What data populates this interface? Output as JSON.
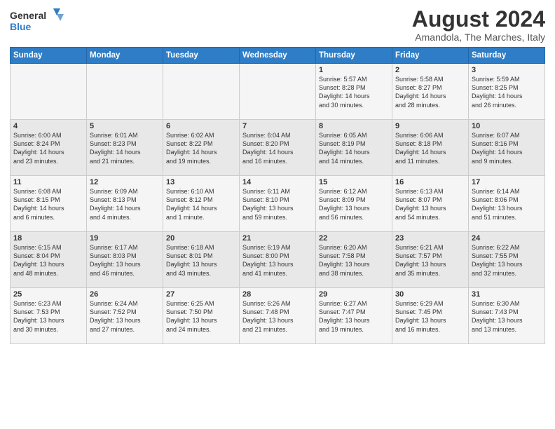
{
  "logo": {
    "line1": "General",
    "line2": "Blue"
  },
  "title": "August 2024",
  "location": "Amandola, The Marches, Italy",
  "days_header": [
    "Sunday",
    "Monday",
    "Tuesday",
    "Wednesday",
    "Thursday",
    "Friday",
    "Saturday"
  ],
  "weeks": [
    [
      {
        "day": "",
        "info": ""
      },
      {
        "day": "",
        "info": ""
      },
      {
        "day": "",
        "info": ""
      },
      {
        "day": "",
        "info": ""
      },
      {
        "day": "1",
        "info": "Sunrise: 5:57 AM\nSunset: 8:28 PM\nDaylight: 14 hours\nand 30 minutes."
      },
      {
        "day": "2",
        "info": "Sunrise: 5:58 AM\nSunset: 8:27 PM\nDaylight: 14 hours\nand 28 minutes."
      },
      {
        "day": "3",
        "info": "Sunrise: 5:59 AM\nSunset: 8:25 PM\nDaylight: 14 hours\nand 26 minutes."
      }
    ],
    [
      {
        "day": "4",
        "info": "Sunrise: 6:00 AM\nSunset: 8:24 PM\nDaylight: 14 hours\nand 23 minutes."
      },
      {
        "day": "5",
        "info": "Sunrise: 6:01 AM\nSunset: 8:23 PM\nDaylight: 14 hours\nand 21 minutes."
      },
      {
        "day": "6",
        "info": "Sunrise: 6:02 AM\nSunset: 8:22 PM\nDaylight: 14 hours\nand 19 minutes."
      },
      {
        "day": "7",
        "info": "Sunrise: 6:04 AM\nSunset: 8:20 PM\nDaylight: 14 hours\nand 16 minutes."
      },
      {
        "day": "8",
        "info": "Sunrise: 6:05 AM\nSunset: 8:19 PM\nDaylight: 14 hours\nand 14 minutes."
      },
      {
        "day": "9",
        "info": "Sunrise: 6:06 AM\nSunset: 8:18 PM\nDaylight: 14 hours\nand 11 minutes."
      },
      {
        "day": "10",
        "info": "Sunrise: 6:07 AM\nSunset: 8:16 PM\nDaylight: 14 hours\nand 9 minutes."
      }
    ],
    [
      {
        "day": "11",
        "info": "Sunrise: 6:08 AM\nSunset: 8:15 PM\nDaylight: 14 hours\nand 6 minutes."
      },
      {
        "day": "12",
        "info": "Sunrise: 6:09 AM\nSunset: 8:13 PM\nDaylight: 14 hours\nand 4 minutes."
      },
      {
        "day": "13",
        "info": "Sunrise: 6:10 AM\nSunset: 8:12 PM\nDaylight: 14 hours\nand 1 minute."
      },
      {
        "day": "14",
        "info": "Sunrise: 6:11 AM\nSunset: 8:10 PM\nDaylight: 13 hours\nand 59 minutes."
      },
      {
        "day": "15",
        "info": "Sunrise: 6:12 AM\nSunset: 8:09 PM\nDaylight: 13 hours\nand 56 minutes."
      },
      {
        "day": "16",
        "info": "Sunrise: 6:13 AM\nSunset: 8:07 PM\nDaylight: 13 hours\nand 54 minutes."
      },
      {
        "day": "17",
        "info": "Sunrise: 6:14 AM\nSunset: 8:06 PM\nDaylight: 13 hours\nand 51 minutes."
      }
    ],
    [
      {
        "day": "18",
        "info": "Sunrise: 6:15 AM\nSunset: 8:04 PM\nDaylight: 13 hours\nand 48 minutes."
      },
      {
        "day": "19",
        "info": "Sunrise: 6:17 AM\nSunset: 8:03 PM\nDaylight: 13 hours\nand 46 minutes."
      },
      {
        "day": "20",
        "info": "Sunrise: 6:18 AM\nSunset: 8:01 PM\nDaylight: 13 hours\nand 43 minutes."
      },
      {
        "day": "21",
        "info": "Sunrise: 6:19 AM\nSunset: 8:00 PM\nDaylight: 13 hours\nand 41 minutes."
      },
      {
        "day": "22",
        "info": "Sunrise: 6:20 AM\nSunset: 7:58 PM\nDaylight: 13 hours\nand 38 minutes."
      },
      {
        "day": "23",
        "info": "Sunrise: 6:21 AM\nSunset: 7:57 PM\nDaylight: 13 hours\nand 35 minutes."
      },
      {
        "day": "24",
        "info": "Sunrise: 6:22 AM\nSunset: 7:55 PM\nDaylight: 13 hours\nand 32 minutes."
      }
    ],
    [
      {
        "day": "25",
        "info": "Sunrise: 6:23 AM\nSunset: 7:53 PM\nDaylight: 13 hours\nand 30 minutes."
      },
      {
        "day": "26",
        "info": "Sunrise: 6:24 AM\nSunset: 7:52 PM\nDaylight: 13 hours\nand 27 minutes."
      },
      {
        "day": "27",
        "info": "Sunrise: 6:25 AM\nSunset: 7:50 PM\nDaylight: 13 hours\nand 24 minutes."
      },
      {
        "day": "28",
        "info": "Sunrise: 6:26 AM\nSunset: 7:48 PM\nDaylight: 13 hours\nand 21 minutes."
      },
      {
        "day": "29",
        "info": "Sunrise: 6:27 AM\nSunset: 7:47 PM\nDaylight: 13 hours\nand 19 minutes."
      },
      {
        "day": "30",
        "info": "Sunrise: 6:29 AM\nSunset: 7:45 PM\nDaylight: 13 hours\nand 16 minutes."
      },
      {
        "day": "31",
        "info": "Sunrise: 6:30 AM\nSunset: 7:43 PM\nDaylight: 13 hours\nand 13 minutes."
      }
    ]
  ]
}
